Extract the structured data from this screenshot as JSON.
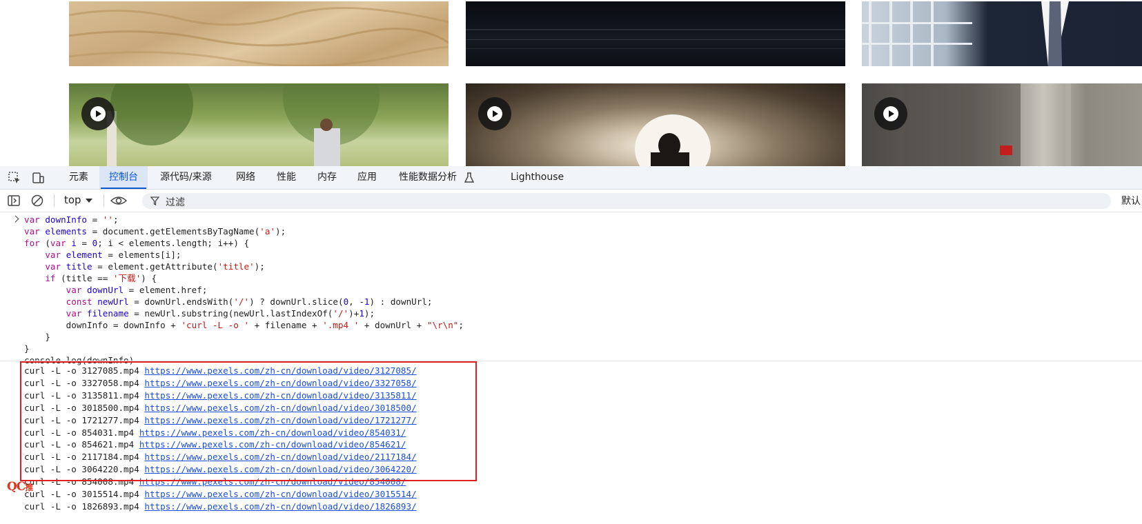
{
  "devtools": {
    "tabs": [
      {
        "label": "元素"
      },
      {
        "label": "控制台",
        "active": true
      },
      {
        "label": "源代码/来源"
      },
      {
        "label": "网络"
      },
      {
        "label": "性能"
      },
      {
        "label": "内存"
      },
      {
        "label": "应用"
      },
      {
        "label": "性能数据分析"
      },
      {
        "label": "Lighthouse"
      }
    ],
    "accent": "#0b57d0",
    "toolbar": {
      "context": "top",
      "filter_placeholder": "过滤",
      "levels": "默认"
    }
  },
  "console": {
    "code": [
      "var downInfo = '';",
      "var elements = document.getElementsByTagName('a');",
      "for (var i = 0; i < elements.length; i++) {",
      "    var element = elements[i];",
      "    var title = element.getAttribute('title');",
      "    if (title == '下载') {",
      "        var downUrl = element.href;",
      "        const newUrl = downUrl.endsWith('/') ? downUrl.slice(0, -1) : downUrl;",
      "        var filename = newUrl.substring(newUrl.lastIndexOf('/')+1);",
      "        downInfo = downInfo + 'curl -L -o ' + filename + '.mp4 ' + downUrl + \"\\r\\n\";",
      "    }",
      "}",
      "console.log(downInfo)"
    ],
    "output": [
      {
        "cmd": "curl -L -o 3127085.mp4",
        "url": "https://www.pexels.com/zh-cn/download/video/3127085/"
      },
      {
        "cmd": "curl -L -o 3327058.mp4",
        "url": "https://www.pexels.com/zh-cn/download/video/3327058/"
      },
      {
        "cmd": "curl -L -o 3135811.mp4",
        "url": "https://www.pexels.com/zh-cn/download/video/3135811/"
      },
      {
        "cmd": "curl -L -o 3018500.mp4",
        "url": "https://www.pexels.com/zh-cn/download/video/3018500/"
      },
      {
        "cmd": "curl -L -o 1721277.mp4",
        "url": "https://www.pexels.com/zh-cn/download/video/1721277/"
      },
      {
        "cmd": "curl -L -o 854031.mp4",
        "url": "https://www.pexels.com/zh-cn/download/video/854031/"
      },
      {
        "cmd": "curl -L -o 854621.mp4",
        "url": "https://www.pexels.com/zh-cn/download/video/854621/"
      },
      {
        "cmd": "curl -L -o 2117184.mp4",
        "url": "https://www.pexels.com/zh-cn/download/video/2117184/"
      },
      {
        "cmd": "curl -L -o 3064220.mp4",
        "url": "https://www.pexels.com/zh-cn/download/video/3064220/"
      },
      {
        "cmd": "curl -L -o 854008.mp4",
        "url": "https://www.pexels.com/zh-cn/download/video/854008/"
      },
      {
        "cmd": "curl -L -o 3015514.mp4",
        "url": "https://www.pexels.com/zh-cn/download/video/3015514/"
      },
      {
        "cmd": "curl -L -o 1826893.mp4",
        "url": "https://www.pexels.com/zh-cn/download/video/1826893/"
      }
    ]
  },
  "watermark": "QC"
}
